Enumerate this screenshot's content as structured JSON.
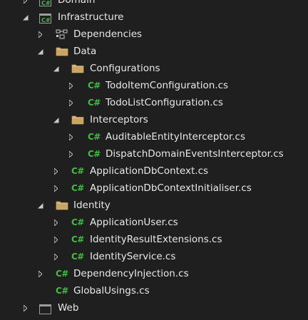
{
  "tree": {
    "rows": [
      {
        "label": "Domain",
        "type": "project",
        "expander": "collapsed"
      },
      {
        "label": "Infrastructure",
        "type": "project",
        "expander": "expanded"
      },
      {
        "label": "Dependencies",
        "type": "dependencies",
        "expander": "collapsed"
      },
      {
        "label": "Data",
        "type": "folder",
        "expander": "expanded"
      },
      {
        "label": "Configurations",
        "type": "folder",
        "expander": "expanded"
      },
      {
        "label": "TodoItemConfiguration.cs",
        "type": "csharp",
        "expander": "collapsed"
      },
      {
        "label": "TodoListConfiguration.cs",
        "type": "csharp",
        "expander": "collapsed"
      },
      {
        "label": "Interceptors",
        "type": "folder",
        "expander": "expanded"
      },
      {
        "label": "AuditableEntityInterceptor.cs",
        "type": "csharp",
        "expander": "collapsed"
      },
      {
        "label": "DispatchDomainEventsInterceptor.cs",
        "type": "csharp",
        "expander": "collapsed"
      },
      {
        "label": "ApplicationDbContext.cs",
        "type": "csharp",
        "expander": "collapsed"
      },
      {
        "label": "ApplicationDbContextInitialiser.cs",
        "type": "csharp",
        "expander": "collapsed"
      },
      {
        "label": "Identity",
        "type": "folder",
        "expander": "expanded"
      },
      {
        "label": "ApplicationUser.cs",
        "type": "csharp",
        "expander": "collapsed"
      },
      {
        "label": "IdentityResultExtensions.cs",
        "type": "csharp",
        "expander": "collapsed"
      },
      {
        "label": "IdentityService.cs",
        "type": "csharp",
        "expander": "collapsed"
      },
      {
        "label": "DependencyInjection.cs",
        "type": "csharp",
        "expander": "collapsed"
      },
      {
        "label": "GlobalUsings.cs",
        "type": "csharp",
        "expander": "none"
      },
      {
        "label": "Web",
        "type": "project",
        "expander": "collapsed"
      }
    ],
    "csharp_glyph": "C#",
    "colors": {
      "background": "#1f1f1f",
      "text": "#e8e8e8",
      "csharp_icon": "#3fbf3f",
      "folder": "#dcb67a",
      "project_border": "#3fbf3f"
    }
  }
}
